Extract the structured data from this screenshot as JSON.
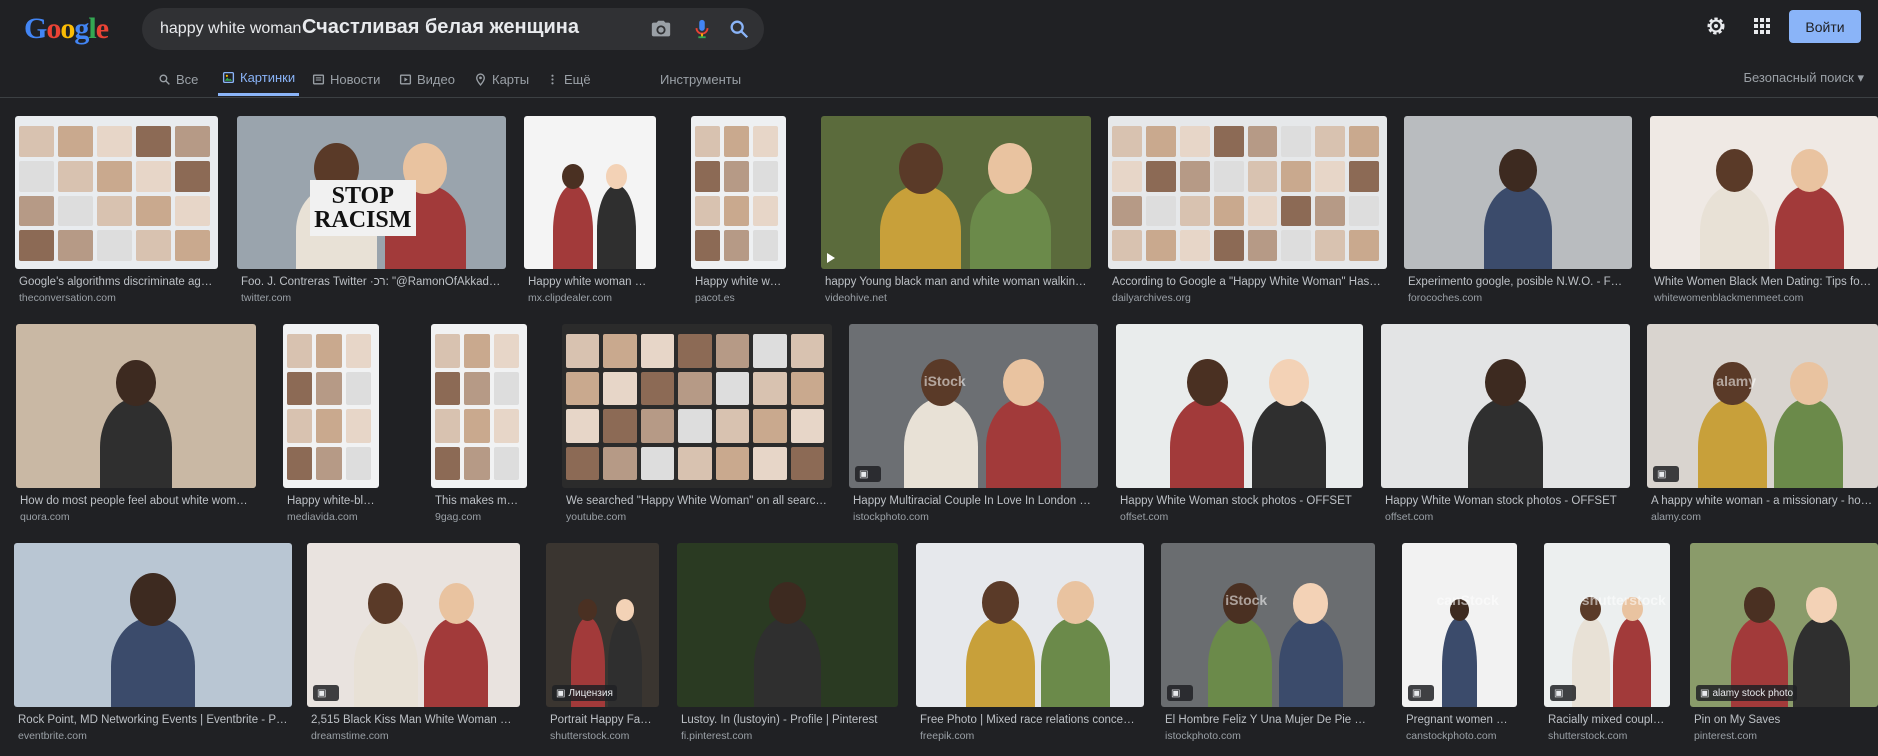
{
  "logo": {
    "letters": [
      "G",
      "o",
      "o",
      "g",
      "l",
      "e"
    ],
    "colors": [
      "#4285f4",
      "#ea4335",
      "#fbbc05",
      "#4285f4",
      "#34a853",
      "#ea4335"
    ]
  },
  "search": {
    "query": "happy white woman",
    "translation": "Счастливая белая женщина"
  },
  "header": {
    "signin_label": "Войти",
    "safesearch_label": "Безопасный поиск"
  },
  "tabs": [
    {
      "label": "Все",
      "icon": "search-icon"
    },
    {
      "label": "Картинки",
      "icon": "image-icon",
      "active": true
    },
    {
      "label": "Новости",
      "icon": "news-icon"
    },
    {
      "label": "Видео",
      "icon": "video-icon"
    },
    {
      "label": "Карты",
      "icon": "map-pin-icon"
    },
    {
      "label": "Ещё",
      "icon": "more-vert-icon"
    },
    {
      "label": "Инструменты",
      "icon": ""
    }
  ],
  "results": [
    [
      {
        "title": "Google's algorithms discriminate agai...",
        "source": "theconversation.com"
      },
      {
        "title": "Foo. J. Contreras Twitter ·רכ: \"@RamonOfAkkad m...",
        "source": "twitter.com",
        "overlay": "STOP RACISM"
      },
      {
        "title": "Happy white woman pr...",
        "source": "mx.clipdealer.com"
      },
      {
        "title": "Happy white woman - ...",
        "source": "pacot.es"
      },
      {
        "title": "happy Young black man and white woman walking i...",
        "source": "videohive.net"
      },
      {
        "title": "According to Google a \"Happy White Woman\" Has a ...",
        "source": "dailyarchives.org"
      },
      {
        "title": "Experimento google, posible N.W.O. - Foro ...",
        "source": "forocoches.com"
      },
      {
        "title": "White Women Black Men Dating: Tips for a ...",
        "source": "whitewomenblackmenmeet.com"
      }
    ],
    [
      {
        "title": "How do most people feel about white women...",
        "source": "quora.com"
      },
      {
        "title": "Happy white-black-asia...",
        "source": "mediavida.com"
      },
      {
        "title": "This makes me puke! S...",
        "source": "9gag.com"
      },
      {
        "title": "We searched \"Happy White Woman\" on all search e...",
        "source": "youtube.com"
      },
      {
        "title": "Happy Multiracial Couple In Love In London Bl...",
        "source": "istockphoto.com",
        "watermark": "iStock"
      },
      {
        "title": "Happy White Woman stock photos - OFFSET",
        "source": "offset.com"
      },
      {
        "title": "Happy White Woman stock photos - OFFSET",
        "source": "offset.com"
      },
      {
        "title": "A happy white woman - a missionary - holdin...",
        "source": "alamy.com",
        "watermark": "alamy"
      }
    ],
    [
      {
        "title": "Rock Point, MD Networking Events | Eventbrite - Page...",
        "source": "eventbrite.com"
      },
      {
        "title": "2,515 Black Kiss Man White Woman Ph...",
        "source": "dreamstime.com"
      },
      {
        "title": "Portrait Happy Famiyj ...",
        "source": "shutterstock.com",
        "badge": "Лицензия"
      },
      {
        "title": "Lustoy. In (lustoyin) - Profile | Pinterest",
        "source": "fi.pinterest.com"
      },
      {
        "title": "Free Photo | Mixed race relations concept. ...",
        "source": "freepik.com"
      },
      {
        "title": "El Hombre Feliz Y Una Mujer De Pie Sob...",
        "source": "istockphoto.com",
        "watermark": "iStock"
      },
      {
        "title": "Pregnant women with ...",
        "source": "canstockphoto.com",
        "watermark": "canStock"
      },
      {
        "title": "Racially mixed couple ...",
        "source": "shutterstock.com",
        "watermark": "shutterstock"
      },
      {
        "title": "Pin on My Saves",
        "source": "pinterest.com",
        "badge": "alamy stock photo"
      }
    ]
  ]
}
